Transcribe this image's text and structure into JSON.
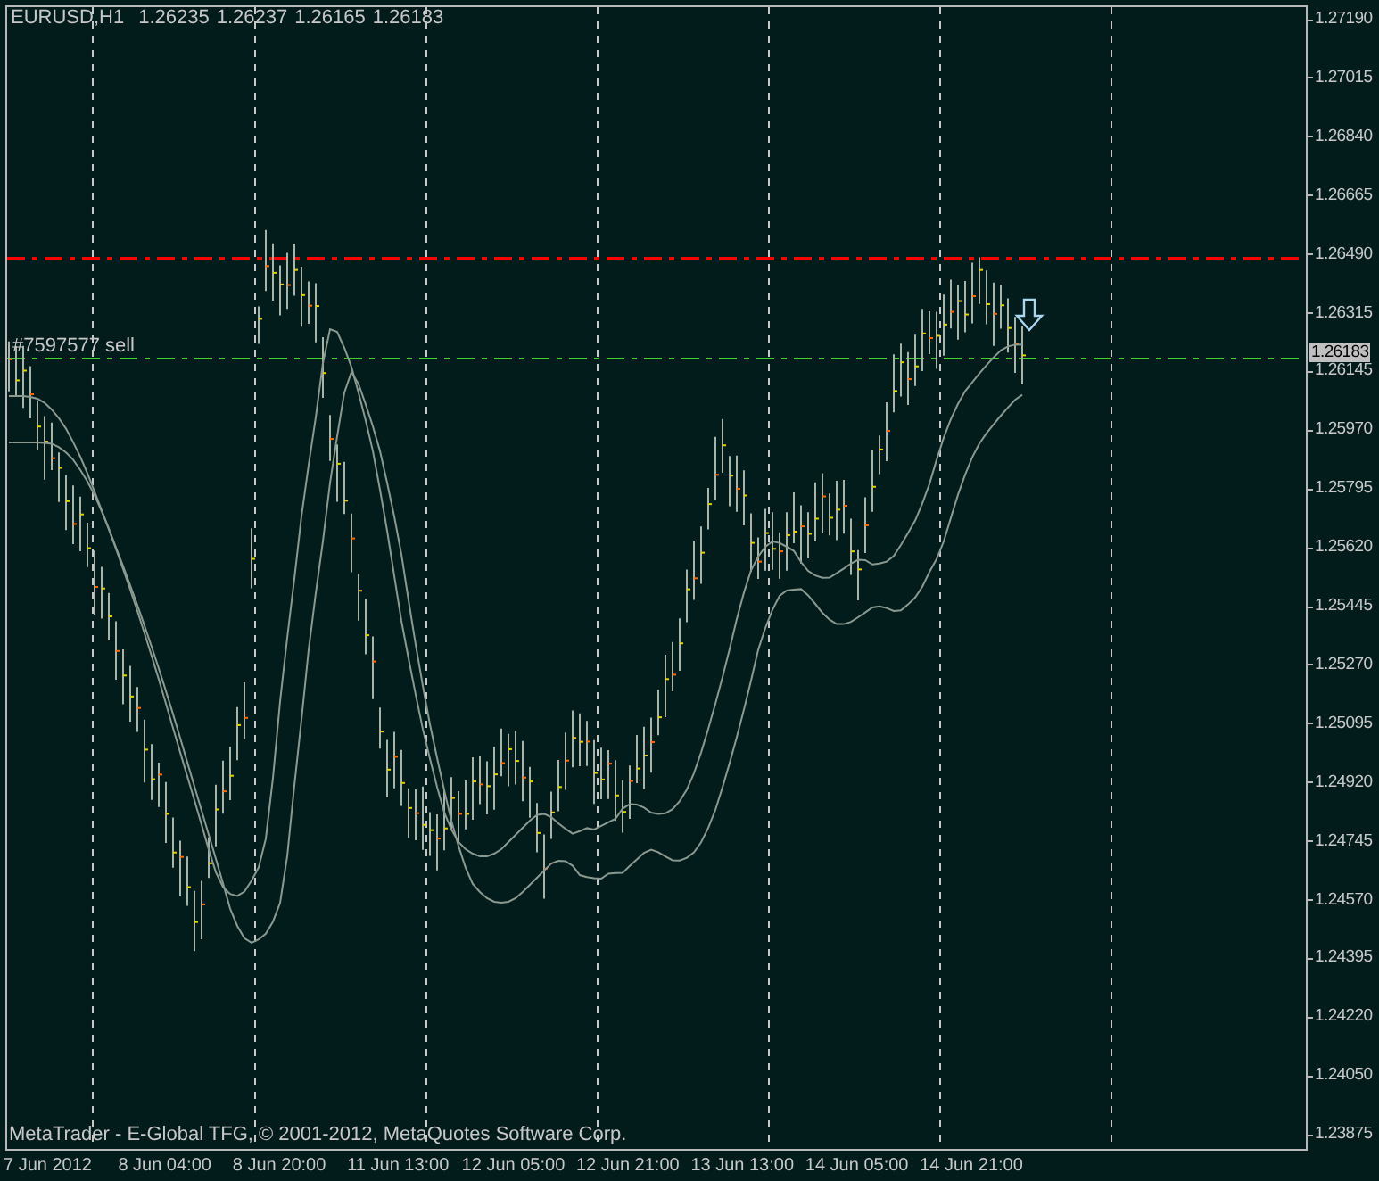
{
  "header": {
    "symbol": "EURUSD,H1",
    "prices": [
      "1.26235",
      "1.26237",
      "1.26165",
      "1.26183"
    ]
  },
  "order_label": "#7597577 sell",
  "price_axis": [
    "1.27190",
    "1.27015",
    "1.26840",
    "1.26665",
    "1.26490",
    "1.26315",
    "1.26145",
    "1.25970",
    "1.25795",
    "1.25620",
    "1.25445",
    "1.25270",
    "1.25095",
    "1.24920",
    "1.24745",
    "1.24570",
    "1.24395",
    "1.24220",
    "1.24050",
    "1.23875"
  ],
  "current_price": "1.26183",
  "time_axis": [
    "7 Jun 2012",
    "8 Jun 04:00",
    "8 Jun 20:00",
    "11 Jun 13:00",
    "12 Jun 05:00",
    "12 Jun 21:00",
    "13 Jun 13:00",
    "14 Jun 05:00",
    "14 Jun 21:00"
  ],
  "copyright": "MetaTrader - E-Global TFG, © 2001-2012, MetaQuotes Software Corp."
}
